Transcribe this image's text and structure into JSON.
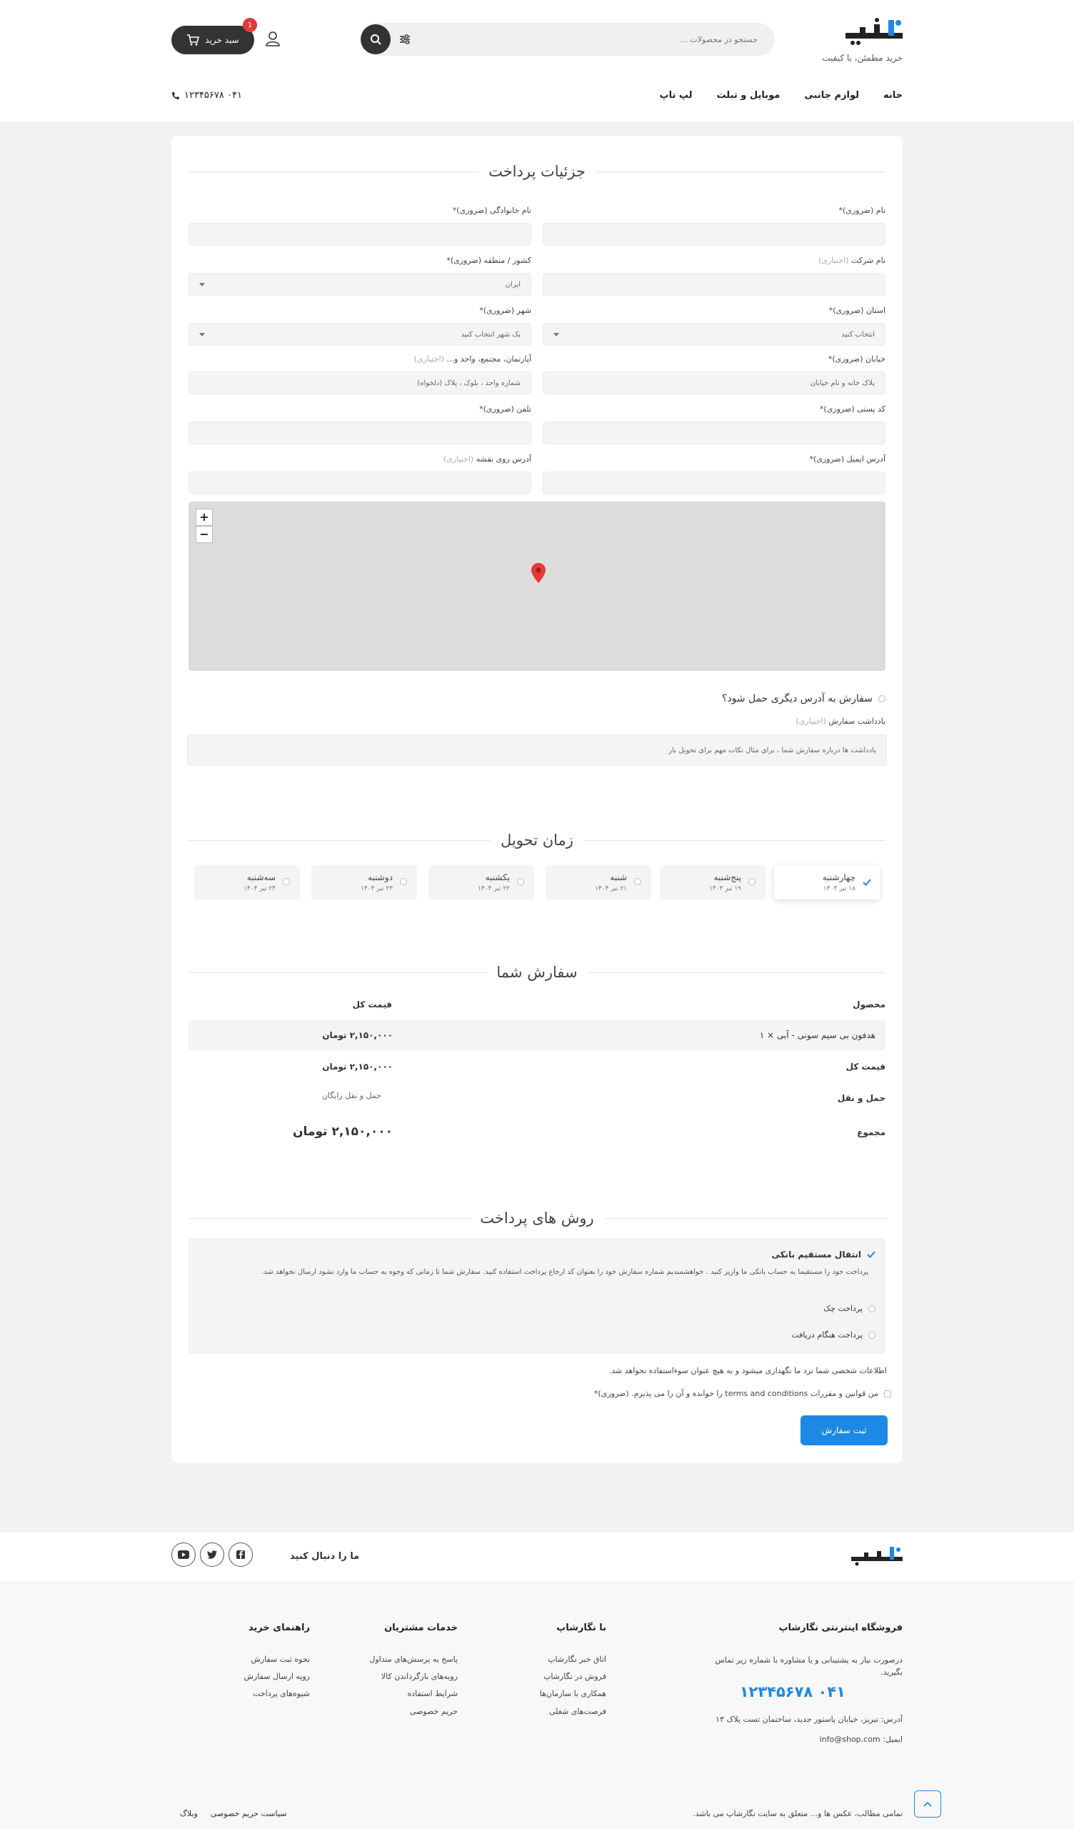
{
  "header": {
    "logo_tagline": "خرید مطمئن، با کیفیت",
    "search_placeholder": "جستجو در محصولات ...",
    "cart_label": "سبد خرید",
    "cart_count": "1",
    "nav": [
      "خانه",
      "لوازم جانبی",
      "موبایل و تبلت",
      "لپ تاپ"
    ],
    "phone": "۰۴۱ ۱۲۳۴۵۶۷۸"
  },
  "billing": {
    "title": "جزئیات پرداخت",
    "first_name_label": "نام (ضروری)*",
    "last_name_label": "نام خانوادگی (ضروری)*",
    "company_label": "نام شرکت",
    "company_optional": "(اختیاری)",
    "country_label": "کشور / منطقه (ضروری)*",
    "country_value": "ایران",
    "state_label": "استان (ضروری)*",
    "state_value": "انتخاب کنید",
    "city_label": "شهر (ضروری)*",
    "city_value": "یک شهر انتخاب کنید",
    "street_label": "خیابان (ضروری)*",
    "street_placeholder": "پلاک خانه و نام خیابان",
    "apartment_label": "آپارتمان، مجتمع، واحد و...",
    "apartment_optional": "(اختیاری)",
    "apartment_placeholder": "شماره واحد ، بلوک ، پلاک (دلخواه)",
    "postcode_label": "کد پستی (ضروری)*",
    "phone_label": "تلفن (ضروری)*",
    "email_label": "آدرس ایمیل (ضروری)*",
    "map_address_label": "آدرس روی نقشه",
    "map_address_optional": "(اختیاری)",
    "ship_other_label": "سفارش به آدرس دیگری حمل شود؟",
    "notes_label": "یادداشت سفارش",
    "notes_optional": "(اختیاری)",
    "notes_placeholder": "یادداشت ها درباره سفارش شما ، برای مثال نکات مهم برای تحویل بار"
  },
  "delivery": {
    "title": "زمان تحویل",
    "days": [
      {
        "name": "چهارشنبه",
        "date": "۱۸ تیر ۱۴۰۴"
      },
      {
        "name": "پنج‌شنبه",
        "date": "۱۹ تیر ۱۴۰۴"
      },
      {
        "name": "شنبه",
        "date": "۲۱ تیر ۱۴۰۴"
      },
      {
        "name": "یکشنبه",
        "date": "۲۲ تیر ۱۴۰۴"
      },
      {
        "name": "دوشنبه",
        "date": "۲۳ تیر ۱۴۰۴"
      },
      {
        "name": "سه‌شنبه",
        "date": "۲۴ تیر ۱۴۰۴"
      }
    ]
  },
  "order": {
    "title": "سفارش شما",
    "col_product": "محصول",
    "col_total": "قیمت کل",
    "product_name": "هدفون بی سیم سونی - آبی  × ۱",
    "product_price": "۲,۱۵۰,۰۰۰ تومان",
    "subtotal_label": "قیمت کل",
    "subtotal_value": "۲,۱۵۰,۰۰۰ تومان",
    "shipping_label": "حمل و نقل",
    "shipping_value": "حمل و نقل رایگان",
    "total_label": "مجموع",
    "total_value": "۲,۱۵۰,۰۰۰ تومان"
  },
  "payment": {
    "title": "روش های پرداخت",
    "bank_label": "انتقال مستقیم بانکی",
    "bank_desc": "پرداخت خود را مستقیما به حساب بانکی ما واریز کنید . خواهشمندیم شماره سفارش خود را بعنوان کد ارجاع پرداخت استفاده کنید. سفارش شما تا زمانی که وجوه به حساب ما وارد نشود ارسال نخواهد شد.",
    "cheque_label": "پرداخت چک",
    "cod_label": "پرداخت هنگام دریافت",
    "privacy_text": "اطلاعات شخصی شما نزد ما نگهداری میشود و به هیچ عنوان سوءاستفاده نخواهد شد.",
    "terms_text": "من قوانین و مقررات terms and conditions را خوانده و آن را می پذیرم. (ضروری)*",
    "submit_label": "ثبت سفارش"
  },
  "footer": {
    "follow_label": "ما را دنبال کنید",
    "store_title": "فروشگاه اینترنتی نگارشاپ",
    "store_desc": "درصورت نیاز به پشتیبانی و یا مشاوره با شماره زیر تماس بگیرید.",
    "store_phone": "۰۴۱ ۱۲۳۴۵۶۷۸",
    "store_address": "آدرس: تبریز، خیابان پاستور جدید، ساختمان تست پلاک ۱۳",
    "store_email": "ایمیل: info@shop.com",
    "col1_title": "با نگارشاپ",
    "col1_links": [
      "اتاق خبر نگارشاپ",
      "فروش در نگارشاپ",
      "همکاری با سازمان‌ها",
      "فرصت‌های شغلی"
    ],
    "col2_title": "خدمات مشتریان",
    "col2_links": [
      "پاسخ به پرسش‌های متداول",
      "رویه‌های بازگرداندن کالا",
      "شرایط استفاده",
      "حریم خصوصی"
    ],
    "col3_title": "راهنمای خرید",
    "col3_links": [
      "نحوه ثبت سفارش",
      "رویه ارسال سفارش",
      "شیوه‌های پرداخت"
    ],
    "copyright": "تمامی مطالب، عکس ها و... متعلق به سایت نگارشاپ می باشد.",
    "bottom_links": [
      "سیاست حریم خصوصی",
      "وبلاگ"
    ]
  },
  "colors": {
    "accent": "#1e88e5",
    "dark": "#333333",
    "badge": "#e53935"
  }
}
